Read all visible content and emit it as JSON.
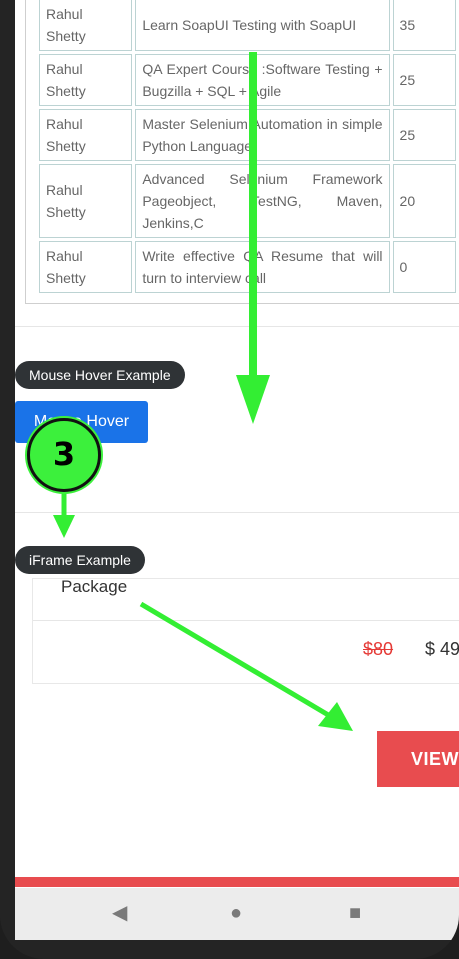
{
  "courses_table": {
    "rows": [
      {
        "instructor": "Rahul Shetty",
        "course": "Learn SoapUI Testing with SoapUI",
        "price": "35"
      },
      {
        "instructor": "Rahul Shetty",
        "course": "QA Expert Course :Software Testing + Bugzilla + SQL + Agile",
        "price": "25"
      },
      {
        "instructor": "Rahul Shetty",
        "course": "Master Selenium Automation in simple Python Language",
        "price": "25"
      },
      {
        "instructor": "Rahul Shetty",
        "course": "Advanced Selenium Framework Pageobject, TestNG, Maven, Jenkins,C",
        "price": "20"
      },
      {
        "instructor": "Rahul Shetty",
        "course": "Write effective QA Resume that will turn to interview call",
        "price": "0"
      }
    ]
  },
  "mouse_hover": {
    "label": "Mouse Hover Example",
    "button_label": "Mouse Hover"
  },
  "iframe": {
    "label": "iFrame Example",
    "package_text": "Package",
    "old_price": "$80",
    "new_price": "$ 49",
    "view_button": "VIEW"
  },
  "annotation": {
    "step_number": "3"
  },
  "navbar": {
    "back_icon": "◀",
    "home_icon": "●",
    "recents_icon": "■"
  },
  "colors": {
    "accent_blue": "#1a73e8",
    "accent_red": "#e84c4f",
    "arrow_green": "#33ee33"
  }
}
